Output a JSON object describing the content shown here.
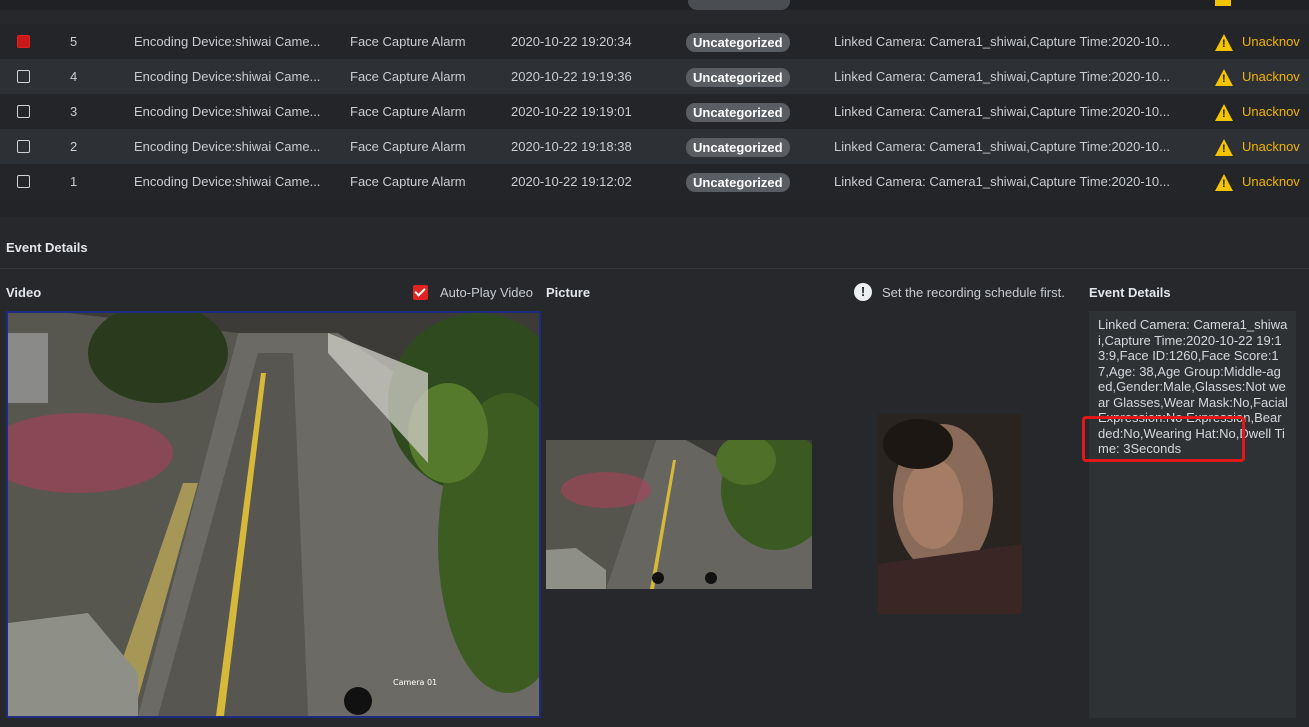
{
  "colors": {
    "background": "#26282c",
    "row_dark": "#232528",
    "row_light": "#2d3034",
    "badge": "#5a5d62",
    "warning": "#f5c400",
    "status_text": "#f0b400",
    "checked_red": "#e02424",
    "highlight_red": "#e01818"
  },
  "event_table": {
    "rows": [
      {
        "index": "5",
        "source": "Encoding Device:shiwai Came...",
        "type": "Face Capture Alarm",
        "time": "2020-10-22 19:20:34",
        "category": "Uncategorized",
        "description": "Linked Camera: Camera1_shiwai,Capture Time:2020-10...",
        "status": "Unacknov",
        "checked": true,
        "icon": "warning-icon"
      },
      {
        "index": "4",
        "source": "Encoding Device:shiwai Came...",
        "type": "Face Capture Alarm",
        "time": "2020-10-22 19:19:36",
        "category": "Uncategorized",
        "description": "Linked Camera: Camera1_shiwai,Capture Time:2020-10...",
        "status": "Unacknov",
        "checked": false,
        "icon": "warning-icon"
      },
      {
        "index": "3",
        "source": "Encoding Device:shiwai Came...",
        "type": "Face Capture Alarm",
        "time": "2020-10-22 19:19:01",
        "category": "Uncategorized",
        "description": "Linked Camera: Camera1_shiwai,Capture Time:2020-10...",
        "status": "Unacknov",
        "checked": false,
        "icon": "warning-icon"
      },
      {
        "index": "2",
        "source": "Encoding Device:shiwai Came...",
        "type": "Face Capture Alarm",
        "time": "2020-10-22 19:18:38",
        "category": "Uncategorized",
        "description": "Linked Camera: Camera1_shiwai,Capture Time:2020-10...",
        "status": "Unacknov",
        "checked": false,
        "icon": "warning-icon"
      },
      {
        "index": "1",
        "source": "Encoding Device:shiwai Came...",
        "type": "Face Capture Alarm",
        "time": "2020-10-22 19:12:02",
        "category": "Uncategorized",
        "description": "Linked Camera: Camera1_shiwai,Capture Time:2020-10...",
        "status": "Unacknov",
        "checked": false,
        "icon": "warning-icon"
      }
    ]
  },
  "event_details": {
    "section_title": "Event Details",
    "video_label": "Video",
    "autoplay_label": "Auto-Play Video",
    "autoplay_checked": true,
    "picture_label": "Picture",
    "notice_icon": "exclamation-circle-icon",
    "notice_text": "Set the recording schedule first.",
    "details_label": "Event Details",
    "details_text": "Linked Camera: Camera1_shiwai,Capture Time:2020-10-22 19:13:9,Face ID:1260,Face Score:17,Age: 38,Age Group:Middle-aged,Gender:Male,Glasses:Not wear Glasses,Wear Mask:No,Facial Expression:No Expression,Bearded:No,Wearing Hat:No,Dwell Time: 3Seconds",
    "video_overlay_text": "Camera 01"
  }
}
